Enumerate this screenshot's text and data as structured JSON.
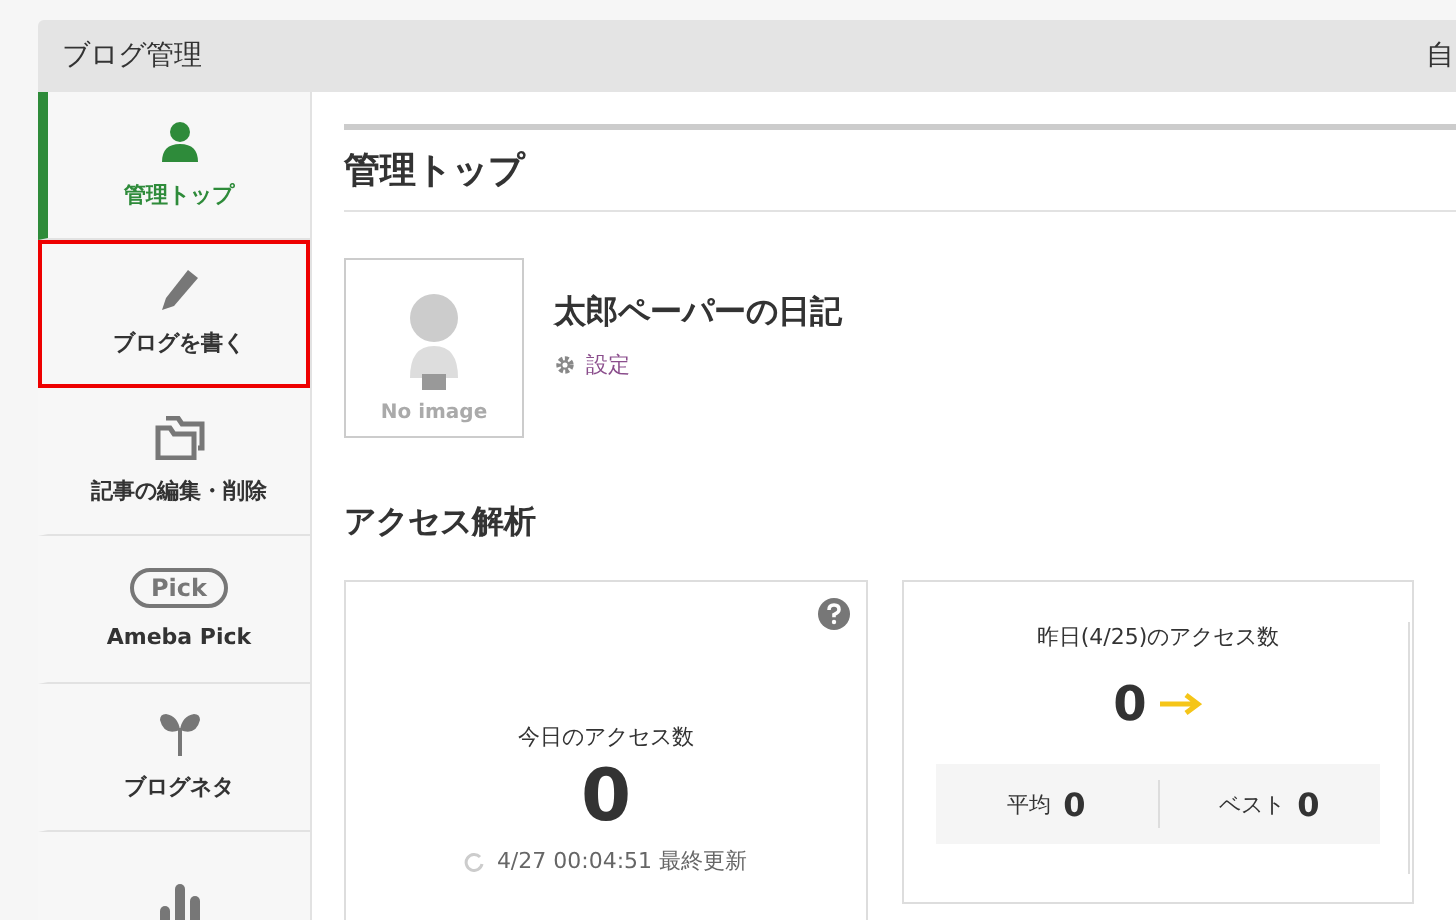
{
  "header": {
    "title": "ブログ管理",
    "right_text": "自"
  },
  "sidebar": {
    "items": [
      {
        "kind": "icon",
        "label": "管理トップ",
        "selected": true,
        "highlighted": false
      },
      {
        "kind": "icon",
        "label": "ブログを書く",
        "selected": false,
        "highlighted": true
      },
      {
        "kind": "icon",
        "label": "記事の編集・削除",
        "selected": false,
        "highlighted": false
      },
      {
        "kind": "badge",
        "badge": "Pick",
        "label": "Ameba Pick",
        "selected": false,
        "highlighted": false
      },
      {
        "kind": "icon",
        "label": "ブログネタ",
        "selected": false,
        "highlighted": false
      },
      {
        "kind": "icon",
        "selected": false,
        "highlighted": false
      }
    ]
  },
  "main": {
    "heading": "管理トップ",
    "profile": {
      "image_caption": "No image",
      "blog_title": "太郎ペーパーの日記",
      "settings_link": "設定"
    },
    "section_heading": "アクセス解析",
    "today": {
      "label": "今日のアクセス数",
      "count": "0",
      "updated": "4/27 00:04:51 最終更新"
    },
    "yesterday": {
      "label": "昨日(4/25)のアクセス数",
      "count": "0",
      "average_label": "平均",
      "average": "0",
      "best_label": "ベスト",
      "best": "0"
    }
  }
}
